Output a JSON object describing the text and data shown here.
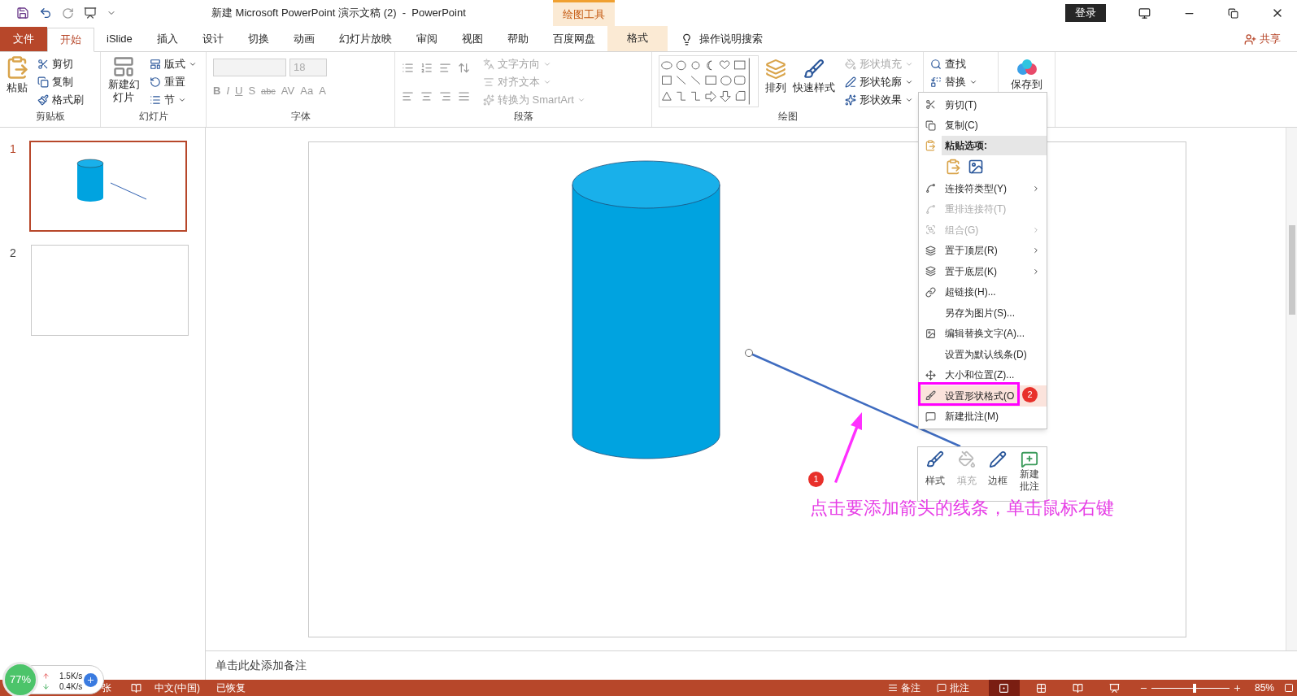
{
  "title_bar": {
    "title": "新建 Microsoft PowerPoint 演示文稿 (2)  -  PowerPoint",
    "contextual_group": "绘图工具",
    "login": "登录"
  },
  "tabs": [
    {
      "label": "文件",
      "kind": "file",
      "selected": false
    },
    {
      "label": "开始",
      "kind": "normal",
      "selected": true
    },
    {
      "label": "iSlide",
      "kind": "normal",
      "selected": false
    },
    {
      "label": "插入",
      "kind": "normal",
      "selected": false
    },
    {
      "label": "设计",
      "kind": "normal",
      "selected": false
    },
    {
      "label": "切换",
      "kind": "normal",
      "selected": false
    },
    {
      "label": "动画",
      "kind": "normal",
      "selected": false
    },
    {
      "label": "幻灯片放映",
      "kind": "normal",
      "selected": false
    },
    {
      "label": "审阅",
      "kind": "normal",
      "selected": false
    },
    {
      "label": "视图",
      "kind": "normal",
      "selected": false
    },
    {
      "label": "帮助",
      "kind": "normal",
      "selected": false
    },
    {
      "label": "百度网盘",
      "kind": "normal",
      "selected": false
    },
    {
      "label": "格式",
      "kind": "contextual",
      "selected": false
    }
  ],
  "tell_me": "操作说明搜索",
  "share": "共享",
  "ribbon": {
    "clipboard": {
      "label": "剪贴板",
      "paste": "粘贴",
      "items": [
        {
          "label": "剪切"
        },
        {
          "label": "复制"
        },
        {
          "label": "格式刷"
        }
      ]
    },
    "slides": {
      "label": "幻灯片",
      "new_slide": "新建幻灯片",
      "items": [
        {
          "label": "版式"
        },
        {
          "label": "重置"
        },
        {
          "label": "节"
        }
      ]
    },
    "font": {
      "label": "字体",
      "size": "18",
      "buttons": [
        "B",
        "I",
        "U",
        "S",
        "abc",
        "AV",
        "Aa",
        "A"
      ]
    },
    "paragraph": {
      "label": "段落",
      "items": [
        {
          "label": "文字方向",
          "disabled": true
        },
        {
          "label": "对齐文本",
          "disabled": true
        },
        {
          "label": "转换为 SmartArt",
          "disabled": true
        }
      ]
    },
    "drawing": {
      "label": "绘图",
      "arrange": "排列",
      "quick_styles": "快速样式",
      "items": [
        {
          "label": "形状填充",
          "disabled": true
        },
        {
          "label": "形状轮廓",
          "disabled": false
        },
        {
          "label": "形状效果",
          "disabled": false
        }
      ]
    },
    "editing": {
      "items": [
        {
          "label": "查找"
        },
        {
          "label": "替换"
        }
      ]
    },
    "save_to": "保存到"
  },
  "slides": [
    {
      "number": "1",
      "selected": true
    },
    {
      "number": "2",
      "selected": false
    }
  ],
  "notes_placeholder": "单击此处添加备注",
  "context_menu": [
    {
      "kind": "item",
      "label": "剪切(T)",
      "disabled": false,
      "submenu": false,
      "highlighted": false
    },
    {
      "kind": "item",
      "label": "复制(C)",
      "disabled": false,
      "submenu": false,
      "highlighted": false
    },
    {
      "kind": "header",
      "label": "粘贴选项:"
    },
    {
      "kind": "paste"
    },
    {
      "kind": "item",
      "label": "连接符类型(Y)",
      "disabled": false,
      "submenu": true,
      "highlighted": false
    },
    {
      "kind": "item",
      "label": "重排连接符(T)",
      "disabled": true,
      "submenu": false,
      "highlighted": false
    },
    {
      "kind": "item",
      "label": "组合(G)",
      "disabled": true,
      "submenu": true,
      "highlighted": false
    },
    {
      "kind": "item",
      "label": "置于顶层(R)",
      "disabled": false,
      "submenu": true,
      "highlighted": false
    },
    {
      "kind": "item",
      "label": "置于底层(K)",
      "disabled": false,
      "submenu": true,
      "highlighted": false
    },
    {
      "kind": "item",
      "label": "超链接(H)...",
      "disabled": false,
      "submenu": false,
      "highlighted": false
    },
    {
      "kind": "item",
      "label": "另存为图片(S)...",
      "disabled": false,
      "submenu": false,
      "highlighted": false
    },
    {
      "kind": "item",
      "label": "编辑替换文字(A)...",
      "disabled": false,
      "submenu": false,
      "highlighted": false
    },
    {
      "kind": "item",
      "label": "设置为默认线条(D)",
      "disabled": false,
      "submenu": false,
      "highlighted": false
    },
    {
      "kind": "item",
      "label": "大小和位置(Z)...",
      "disabled": false,
      "submenu": false,
      "highlighted": false
    },
    {
      "kind": "item",
      "label": "设置形状格式(O",
      "disabled": false,
      "submenu": false,
      "highlighted": true
    },
    {
      "kind": "item",
      "label": "新建批注(M)",
      "disabled": false,
      "submenu": false,
      "highlighted": false
    }
  ],
  "mini_toolbar": [
    {
      "label": "样式",
      "disabled": false
    },
    {
      "label": "填充",
      "disabled": true
    },
    {
      "label": "边框",
      "disabled": false
    },
    {
      "label": "新建批注",
      "disabled": false
    }
  ],
  "annotation": {
    "step_one": "1",
    "step_two": "2",
    "text": "点击要添加箭头的线条，单击鼠标右键"
  },
  "network_widget": {
    "percent": "77%",
    "up": "1.5K/s",
    "down": "0.4K/s"
  },
  "status_bar": {
    "left": [
      "张",
      "中文(中国)",
      "已恢复"
    ],
    "notes": "备注",
    "comments": "批注",
    "zoom": "85%",
    "zoom_slider": {
      "level": 0.55
    }
  }
}
